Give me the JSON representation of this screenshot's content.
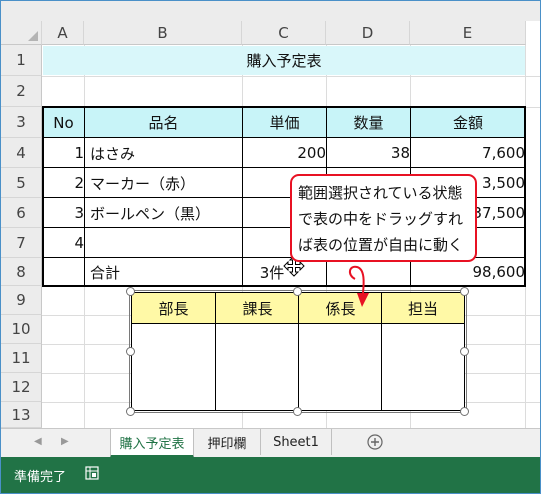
{
  "columns": [
    "A",
    "B",
    "C",
    "D",
    "E"
  ],
  "rows": [
    "1",
    "2",
    "3",
    "4",
    "5",
    "6",
    "7",
    "8",
    "9",
    "10",
    "11",
    "12",
    "13"
  ],
  "sheet": {
    "title": "購入予定表",
    "headers": {
      "no": "No",
      "name": "品名",
      "price": "単価",
      "qty": "数量",
      "amount": "金額"
    },
    "items": [
      {
        "no": "1",
        "name": "はさみ",
        "price": "200",
        "qty": "38",
        "amount": "7,600"
      },
      {
        "no": "2",
        "name": "マーカー（赤）",
        "price": "",
        "qty": "",
        "amount": "3,500"
      },
      {
        "no": "3",
        "name": "ボールペン（黒）",
        "price": "",
        "qty": "",
        "amount": "37,500"
      },
      {
        "no": "4",
        "name": "",
        "price": "",
        "qty": "",
        "amount": ""
      }
    ],
    "total_label": "合計",
    "total_qty": "3件",
    "total_amount": "98,600"
  },
  "stamp_table": {
    "headers": [
      "部長",
      "課長",
      "係長",
      "担当"
    ]
  },
  "callout": {
    "text": "範囲選択されている状態で表の中をドラッグすれば表の位置が自由に動く",
    "border_color": "#e81123"
  },
  "tabs": {
    "active": "購入予定表",
    "items": [
      "押印欄",
      "Sheet1"
    ],
    "add_icon": "plus-circle-icon",
    "nav_icons": [
      "chevron-left-icon",
      "chevron-right-icon"
    ]
  },
  "status": {
    "ready": "準備完了",
    "macro_icon": "macro-record-icon"
  },
  "colors": {
    "title_fill": "#d9f7fa",
    "header_fill": "#c8f4f8",
    "stamp_fill": "#fff9a6",
    "status_bar": "#217346"
  }
}
